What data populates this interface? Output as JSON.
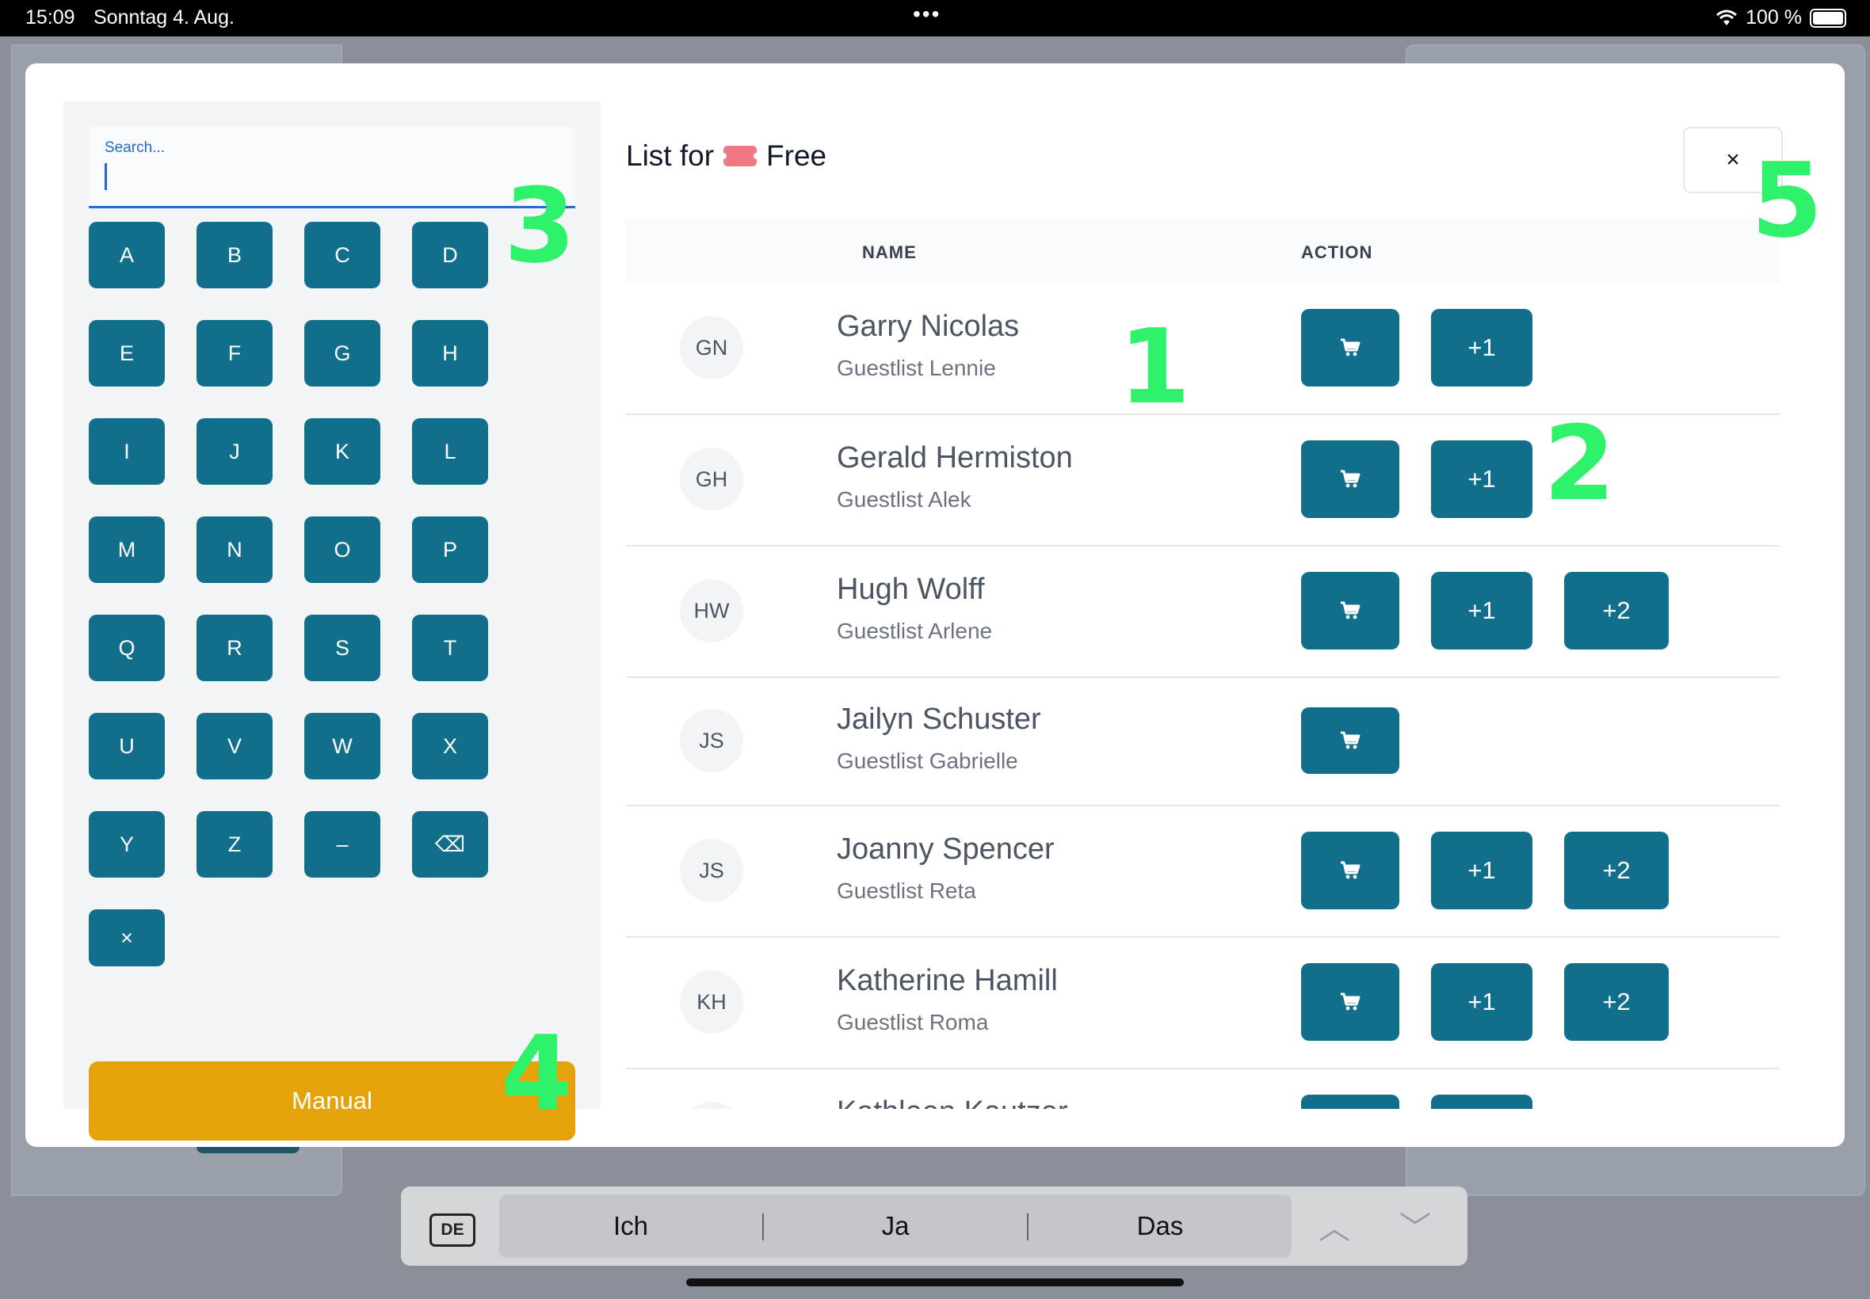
{
  "status": {
    "time": "15:09",
    "date": "Sonntag 4. Aug.",
    "battery": "100 %",
    "dots": "•••"
  },
  "search": {
    "label": "Search..."
  },
  "keys": [
    [
      "A",
      "B",
      "C",
      "D"
    ],
    [
      "E",
      "F",
      "G",
      "H"
    ],
    [
      "I",
      "J",
      "K",
      "L"
    ],
    [
      "M",
      "N",
      "O",
      "P"
    ],
    [
      "Q",
      "R",
      "S",
      "T"
    ],
    [
      "U",
      "V",
      "W",
      "X"
    ],
    [
      "Y",
      "Z",
      "–",
      "⌫"
    ],
    [
      "×"
    ]
  ],
  "manual_label": "Manual",
  "header": {
    "title_prefix": "List for",
    "title_suffix": "Free",
    "ticket_text": "ADMIT ONE"
  },
  "close_label": "×",
  "table": {
    "col_name": "NAME",
    "col_action": "ACTION"
  },
  "rows": [
    {
      "initials": "GN",
      "name": "Garry Nicolas",
      "sub": "Guestlist Lennie",
      "actions": [
        "cart",
        "+1"
      ]
    },
    {
      "initials": "GH",
      "name": "Gerald Hermiston",
      "sub": "Guestlist Alek",
      "actions": [
        "cart",
        "+1"
      ]
    },
    {
      "initials": "HW",
      "name": "Hugh Wolff",
      "sub": "Guestlist Arlene",
      "actions": [
        "cart",
        "+1",
        "+2"
      ]
    },
    {
      "initials": "JS",
      "name": "Jailyn Schuster",
      "sub": "Guestlist Gabrielle",
      "actions": [
        "cart"
      ]
    },
    {
      "initials": "JS",
      "name": "Joanny Spencer",
      "sub": "Guestlist Reta",
      "actions": [
        "cart",
        "+1",
        "+2"
      ]
    },
    {
      "initials": "KH",
      "name": "Katherine Hamill",
      "sub": "Guestlist Roma",
      "actions": [
        "cart",
        "+1",
        "+2"
      ]
    },
    {
      "initials": "KK",
      "name": "Kathleen Kautzer",
      "sub": "",
      "actions": [
        "cart",
        "+1"
      ]
    }
  ],
  "markers": [
    "1",
    "2",
    "3",
    "4",
    "5"
  ],
  "keyboard": {
    "lang": "DE",
    "suggestions": [
      "Ich",
      "Ja",
      "Das"
    ],
    "up": "︿",
    "down": "﹀"
  },
  "colors": {
    "primary": "#126f8c",
    "manual": "#e5a20b",
    "marker": "#2ef26a",
    "focus": "#1d6ad8"
  }
}
